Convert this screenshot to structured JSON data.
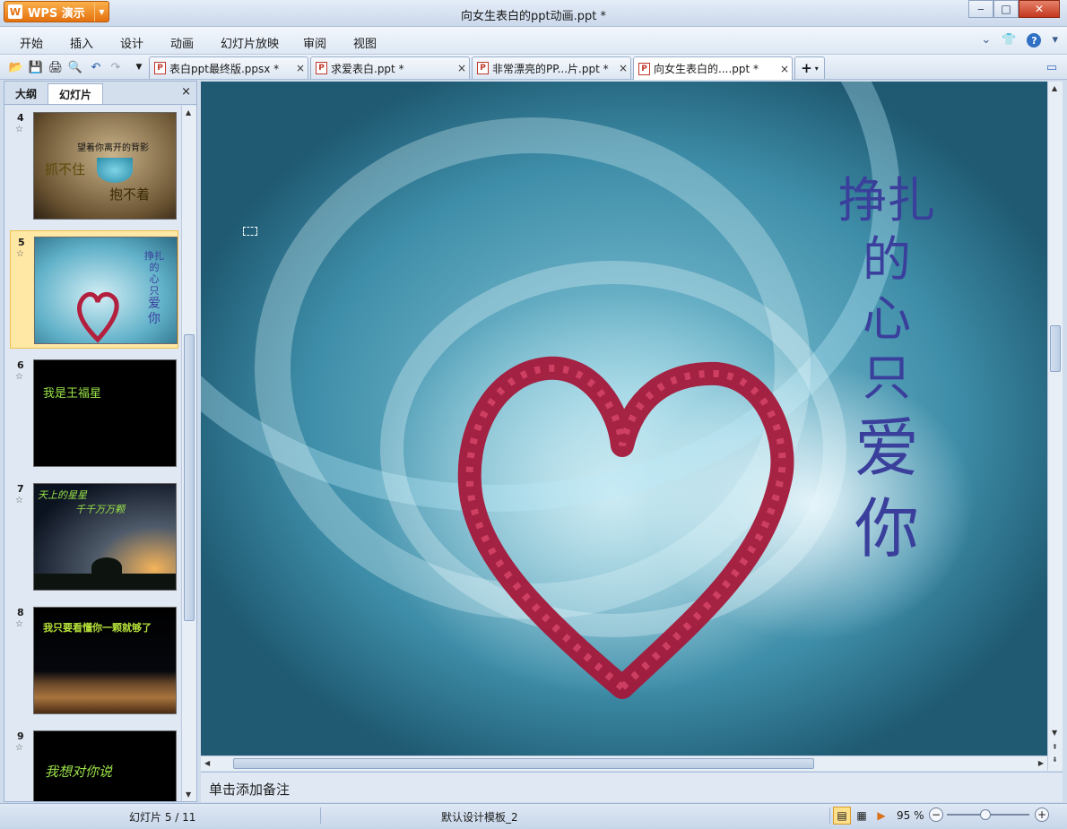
{
  "window": {
    "app_name": "WPS 演示",
    "title": "向女生表白的ppt动画.ppt *"
  },
  "menu": {
    "items": [
      "开始",
      "插入",
      "设计",
      "动画",
      "幻灯片放映",
      "审阅",
      "视图"
    ]
  },
  "tabs": [
    {
      "label": "表白ppt最终版.ppsx *",
      "close": "×"
    },
    {
      "label": "求爱表白.ppt *",
      "close": "×"
    },
    {
      "label": "非常漂亮的PP...片.ppt *",
      "close": "×"
    },
    {
      "label": "向女生表白的....ppt *",
      "close": "×"
    }
  ],
  "left_panel": {
    "tabs": [
      "大纲",
      "幻灯片"
    ],
    "close": "×",
    "slides": [
      {
        "num": "4",
        "texts": [
          "望着你离开的背影",
          "抓不住",
          "抱不着"
        ]
      },
      {
        "num": "5",
        "texts": [
          "挣扎",
          "的",
          "心",
          "只",
          "爱",
          "你"
        ]
      },
      {
        "num": "6",
        "texts": [
          "我是王福星"
        ]
      },
      {
        "num": "7",
        "texts": [
          "天上的星星",
          "千千万万颗"
        ]
      },
      {
        "num": "8",
        "texts": [
          "我只要看懂你一颗就够了"
        ]
      },
      {
        "num": "9",
        "texts": [
          "我想对你说"
        ]
      }
    ]
  },
  "slide": {
    "lines": [
      "挣扎",
      "的",
      "心",
      "只",
      "爱",
      "你"
    ]
  },
  "notes": {
    "placeholder": "单击添加备注"
  },
  "status": {
    "slide_info": "幻灯片 5 / 11",
    "template": "默认设计模板_2",
    "zoom": "95 %",
    "zoom_value": 95
  }
}
